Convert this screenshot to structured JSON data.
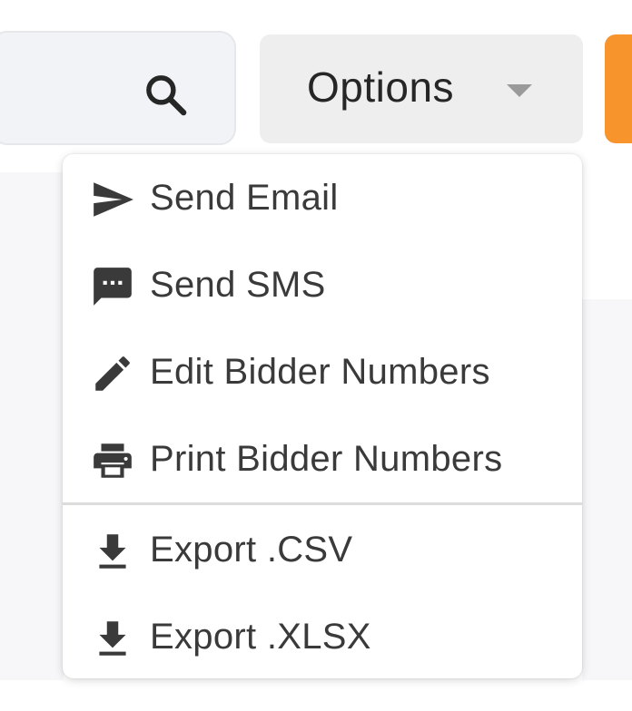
{
  "search": {
    "icon": "search-icon",
    "value": ""
  },
  "options_button": {
    "label": "Options",
    "icon": "caret-down-icon"
  },
  "menu": {
    "items": [
      {
        "label": "Send Email",
        "icon": "send-icon"
      },
      {
        "label": "Send SMS",
        "icon": "sms-icon"
      },
      {
        "label": "Edit Bidder Numbers",
        "icon": "pencil-icon"
      },
      {
        "label": "Print Bidder Numbers",
        "icon": "printer-icon"
      },
      {
        "label": "Export .CSV",
        "icon": "download-icon"
      },
      {
        "label": "Export .XLSX",
        "icon": "download-icon"
      }
    ]
  },
  "colors": {
    "accent_orange": "#f7952c",
    "button_bg": "#eeeeee",
    "icon_color": "#3a3a3a"
  }
}
